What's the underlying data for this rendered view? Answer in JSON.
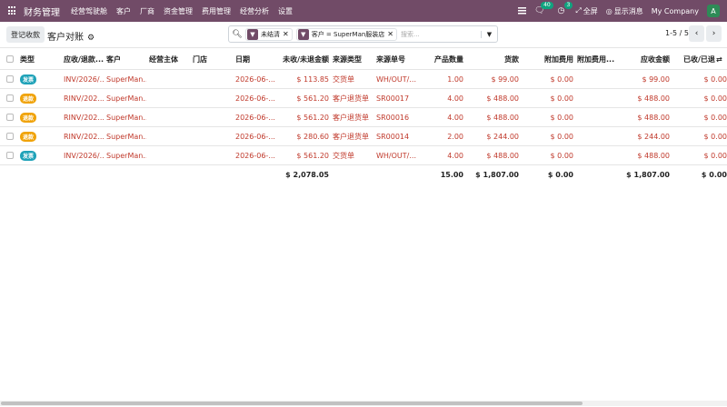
{
  "topbar": {
    "app_title": "财务管理",
    "menu": [
      "经营驾驶舱",
      "客户",
      "厂商",
      "资金管理",
      "费用管理",
      "经营分析",
      "设置"
    ],
    "chat_count": "40",
    "activity_count": "3",
    "fullscreen_label": "全屏",
    "messages_label": "显示消息",
    "company": "My Company",
    "avatar_letter": "A"
  },
  "control": {
    "register_button": "登记收款",
    "breadcrumb": "客户对账",
    "facet_1": "未结清",
    "facet_2": "客户 = SuperMan服装店",
    "search_placeholder": "搜索...",
    "pager": "1-5 / 5"
  },
  "table": {
    "headers": [
      "类型",
      "应收/退款...",
      "客户",
      "经营主体",
      "门店",
      "日期",
      "未收/未退金额",
      "来源类型",
      "来源单号",
      "产品数量",
      "货款",
      "附加费用",
      "附加费用...",
      "应收金额",
      "已收/已退"
    ],
    "rows": [
      {
        "type": "发票",
        "ref": "INV/2026/...",
        "customer": "SuperMan...",
        "entity": "",
        "store": "",
        "date": "2026-06-...",
        "unpaid": "$ 113.85",
        "source_type": "交货单",
        "source_ref": "WH/OUT/...",
        "qty": "1.00",
        "goods": "$ 99.00",
        "extra": "$ 0.00",
        "extra2": "",
        "receivable": "$ 99.00",
        "received": "$ 0.00"
      },
      {
        "type": "退款",
        "ref": "RINV/202...",
        "customer": "SuperMan...",
        "entity": "",
        "store": "",
        "date": "2026-06-...",
        "unpaid": "$ 561.20",
        "source_type": "客户退货单",
        "source_ref": "SR00017",
        "qty": "4.00",
        "goods": "$ 488.00",
        "extra": "$ 0.00",
        "extra2": "",
        "receivable": "$ 488.00",
        "received": "$ 0.00"
      },
      {
        "type": "退款",
        "ref": "RINV/202...",
        "customer": "SuperMan...",
        "entity": "",
        "store": "",
        "date": "2026-06-...",
        "unpaid": "$ 561.20",
        "source_type": "客户退货单",
        "source_ref": "SR00016",
        "qty": "4.00",
        "goods": "$ 488.00",
        "extra": "$ 0.00",
        "extra2": "",
        "receivable": "$ 488.00",
        "received": "$ 0.00"
      },
      {
        "type": "退款",
        "ref": "RINV/202...",
        "customer": "SuperMan...",
        "entity": "",
        "store": "",
        "date": "2026-06-...",
        "unpaid": "$ 280.60",
        "source_type": "客户退货单",
        "source_ref": "SR00014",
        "qty": "2.00",
        "goods": "$ 244.00",
        "extra": "$ 0.00",
        "extra2": "",
        "receivable": "$ 244.00",
        "received": "$ 0.00"
      },
      {
        "type": "发票",
        "ref": "INV/2026/...",
        "customer": "SuperMan...",
        "entity": "",
        "store": "",
        "date": "2026-06-...",
        "unpaid": "$ 561.20",
        "source_type": "交货单",
        "source_ref": "WH/OUT/...",
        "qty": "4.00",
        "goods": "$ 488.00",
        "extra": "$ 0.00",
        "extra2": "",
        "receivable": "$ 488.00",
        "received": "$ 0.00"
      }
    ],
    "totals": {
      "unpaid": "$ 2,078.05",
      "qty": "15.00",
      "goods": "$ 1,807.00",
      "extra": "$ 0.00",
      "receivable": "$ 1,807.00",
      "received": "$ 0.00"
    }
  },
  "colors": {
    "brand": "#714b67",
    "invoice_badge": "#1fa2b8",
    "refund_badge": "#f0a30a",
    "link_red": "#c0392b"
  },
  "icons": {
    "apps": "apps-grid-icon",
    "search": "search-icon",
    "filter": "funnel-icon",
    "settings": "gear-icon"
  }
}
